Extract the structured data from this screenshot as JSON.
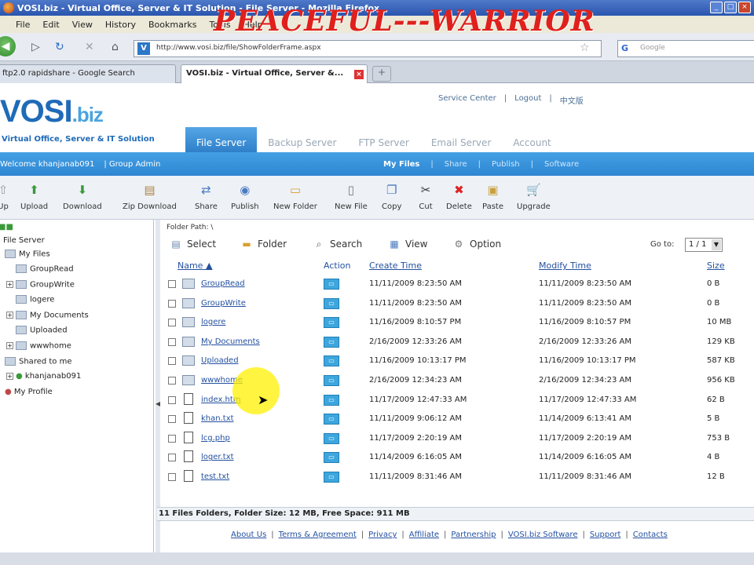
{
  "browser": {
    "window_title": "VOSI.biz - Virtual Office, Server & IT Solution - File Server - Mozilla Firefox",
    "watermark": "PEACEFUL---WARRIOR",
    "menu": [
      "File",
      "Edit",
      "View",
      "History",
      "Bookmarks",
      "Tools",
      "Help"
    ],
    "url": "http://www.vosi.biz/file/ShowFolderFrame.aspx",
    "search_placeholder": "Google",
    "tabs": [
      {
        "label": "ftp2.0 rapidshare - Google Search"
      },
      {
        "label": "VOSI.biz - Virtual Office, Server &..."
      }
    ]
  },
  "site": {
    "logo_main": "VOSI",
    "logo_ext": ".biz",
    "tagline": "Virtual Office, Server & IT Solution",
    "top_links": [
      "Service Center",
      "|",
      "Logout",
      "|",
      "中文版"
    ],
    "main_tabs": [
      "File Server",
      "Backup Server",
      "FTP Server",
      "Email Server",
      "Account"
    ],
    "welcome": "Welcome khanjanab091",
    "group_admin": "| Group Admin",
    "sub_tabs": [
      "My Files",
      "|",
      "Share",
      "|",
      "Publish",
      "|",
      "Software"
    ]
  },
  "toolbar": [
    "Up",
    "Upload",
    "Download",
    "Zip Download",
    "Share",
    "Publish",
    "New Folder",
    "New File",
    "Copy",
    "Cut",
    "Delete",
    "Paste",
    "Upgrade"
  ],
  "tree": {
    "root": "File Server",
    "my_files": "My Files",
    "items": [
      "GroupRead",
      "GroupWrite",
      "logere",
      "My Documents",
      "Uploaded",
      "wwwhome"
    ],
    "shared": "Shared to me",
    "shared_user": "khanjanab091",
    "profile": "My Profile"
  },
  "content": {
    "folder_path_label": "Folder Path:",
    "folder_path": "\\",
    "actions": [
      "Select",
      "Folder",
      "Search",
      "View",
      "Option"
    ],
    "goto_label": "Go to:",
    "page": "1 / 1",
    "columns": {
      "name": "Name",
      "action": "Action",
      "create": "Create Time",
      "modify": "Modify Time",
      "size": "Size"
    },
    "rows": [
      {
        "name": "GroupRead",
        "type": "folder",
        "create": "11/11/2009 8:23:50 AM",
        "modify": "11/11/2009 8:23:50 AM",
        "size": "0 B"
      },
      {
        "name": "GroupWrite",
        "type": "folder",
        "create": "11/11/2009 8:23:50 AM",
        "modify": "11/11/2009 8:23:50 AM",
        "size": "0 B"
      },
      {
        "name": "logere",
        "type": "folder",
        "create": "11/16/2009 8:10:57 PM",
        "modify": "11/16/2009 8:10:57 PM",
        "size": "10 MB"
      },
      {
        "name": "My Documents",
        "type": "folder",
        "create": "2/16/2009 12:33:26 AM",
        "modify": "2/16/2009 12:33:26 AM",
        "size": "129 KB"
      },
      {
        "name": "Uploaded",
        "type": "folder",
        "create": "11/16/2009 10:13:17 PM",
        "modify": "11/16/2009 10:13:17 PM",
        "size": "587 KB"
      },
      {
        "name": "wwwhome",
        "type": "folder",
        "create": "2/16/2009 12:34:23 AM",
        "modify": "2/16/2009 12:34:23 AM",
        "size": "956 KB"
      },
      {
        "name": "index.htm",
        "type": "file",
        "create": "11/17/2009 12:47:33 AM",
        "modify": "11/17/2009 12:47:33 AM",
        "size": "62 B"
      },
      {
        "name": "khan.txt",
        "type": "file",
        "create": "11/11/2009 9:06:12 AM",
        "modify": "11/14/2009 6:13:41 AM",
        "size": "5 B"
      },
      {
        "name": "lcg.php",
        "type": "file",
        "create": "11/17/2009 2:20:19 AM",
        "modify": "11/17/2009 2:20:19 AM",
        "size": "753 B"
      },
      {
        "name": "loger.txt",
        "type": "file",
        "create": "11/14/2009 6:16:05 AM",
        "modify": "11/14/2009 6:16:05 AM",
        "size": "4 B"
      },
      {
        "name": "test.txt",
        "type": "file",
        "create": "11/11/2009 8:31:46 AM",
        "modify": "11/11/2009 8:31:46 AM",
        "size": "12 B"
      }
    ],
    "status": "11 Files Folders, Folder Size: 12 MB, Free Space: 911 MB"
  },
  "footer": [
    "About Us",
    "Terms & Agreement",
    "Privacy",
    "Affiliate",
    "Partnership",
    "VOSI.biz Software",
    "Support",
    "Contacts"
  ]
}
